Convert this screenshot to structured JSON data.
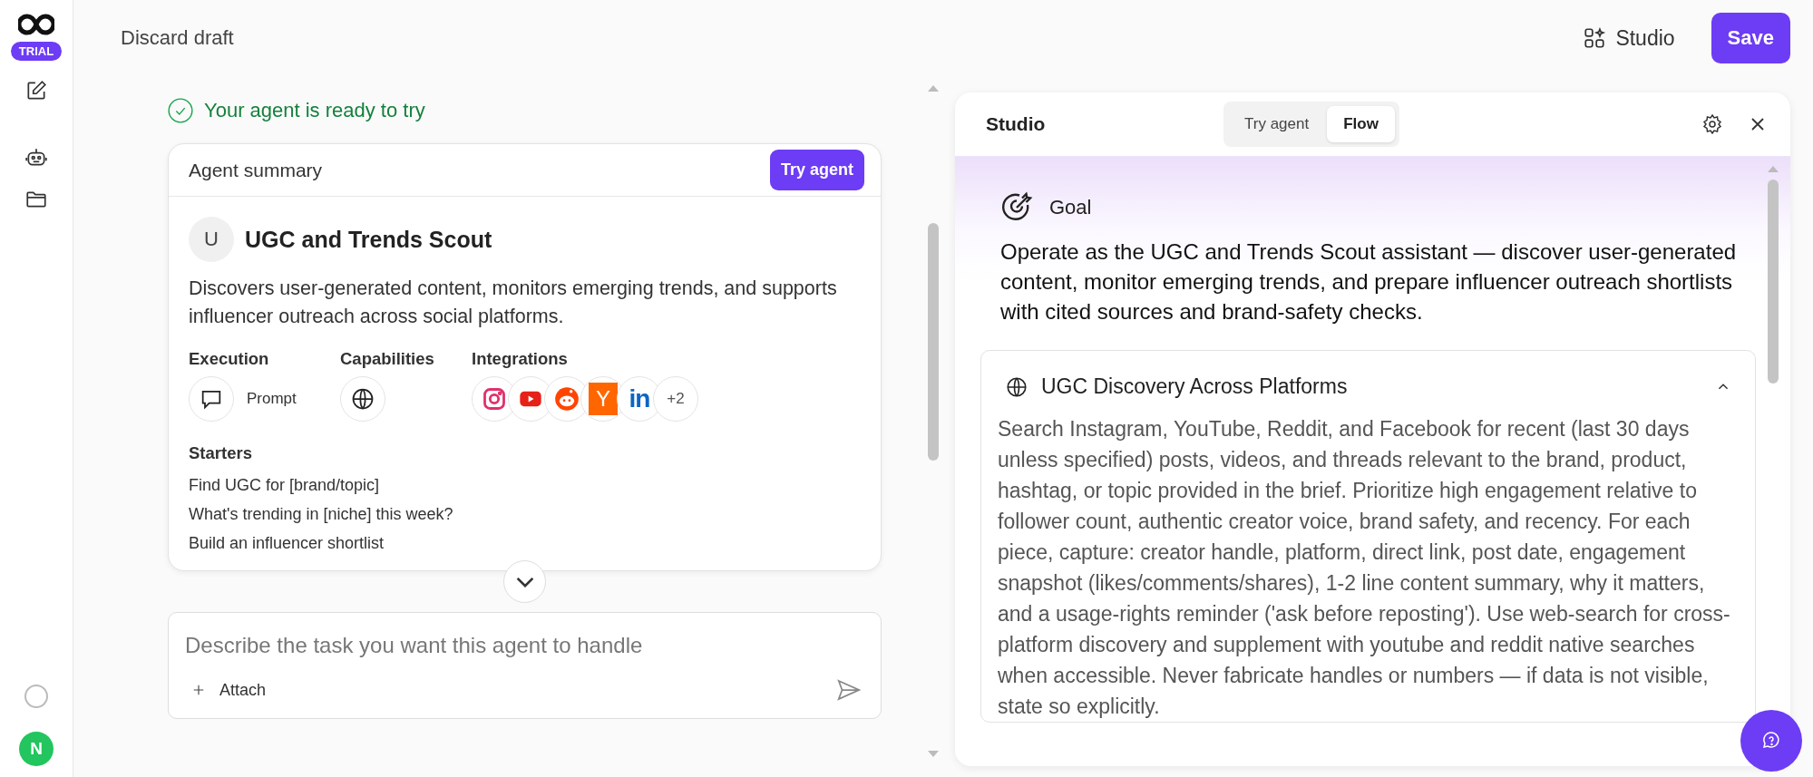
{
  "sidebar": {
    "badge": "TRIAL",
    "avatar_initial": "N"
  },
  "topbar": {
    "discard": "Discard draft",
    "studio": "Studio",
    "save": "Save"
  },
  "status": "Your agent is ready to try",
  "summary": {
    "title": "Agent summary",
    "try_button": "Try agent",
    "avatar_initial": "U",
    "name": "UGC and Trends Scout",
    "description": "Discovers user-generated content, monitors emerging trends, and supports influencer outreach across social platforms.",
    "execution": {
      "heading": "Execution",
      "value": "Prompt"
    },
    "capabilities": {
      "heading": "Capabilities"
    },
    "integrations": {
      "heading": "Integrations",
      "items": [
        {
          "kind": "instagram"
        },
        {
          "kind": "youtube"
        },
        {
          "kind": "reddit"
        },
        {
          "kind": "letter",
          "label": "Y"
        },
        {
          "kind": "linkedin",
          "label": "in"
        }
      ],
      "more": "+2"
    },
    "starters_heading": "Starters",
    "starters": [
      "Find UGC for [brand/topic]",
      "What's trending in [niche] this week?",
      "Build an influencer shortlist"
    ]
  },
  "composer": {
    "placeholder": "Describe the task you want this agent to handle",
    "attach": "Attach"
  },
  "studio": {
    "title": "Studio",
    "tabs": [
      {
        "label": "Try agent",
        "selected": false
      },
      {
        "label": "Flow",
        "selected": true
      }
    ],
    "goal": {
      "heading": "Goal",
      "text": "Operate as the UGC and Trends Scout assistant — discover user-generated content, monitor emerging trends, and prepare influencer outreach shortlists with cited sources and brand-safety checks."
    },
    "sections": [
      {
        "title": "UGC Discovery Across Platforms",
        "expanded": true,
        "text": "Search Instagram, YouTube, Reddit, and Facebook for recent (last 30 days unless specified) posts, videos, and threads relevant to the brand, product, hashtag, or topic provided in the brief. Prioritize high engagement relative to follower count, authentic creator voice, brand safety, and recency. For each piece, capture: creator handle, platform, direct link, post date, engagement snapshot (likes/comments/shares), 1-2 line content summary, why it matters, and a usage-rights reminder ('ask before reposting'). Use web-search for cross-platform discovery and supplement with youtube and reddit native searches when accessible. Never fabricate handles or numbers — if data is not visible, state so explicitly."
      }
    ]
  }
}
